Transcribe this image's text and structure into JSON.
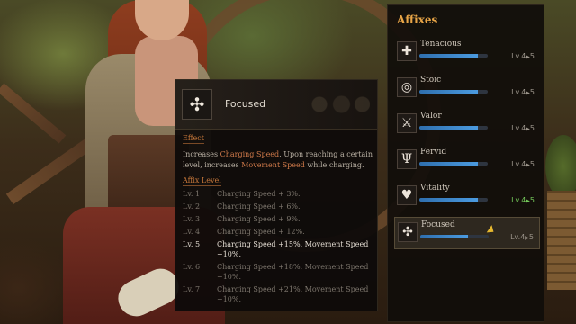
{
  "affixes_panel": {
    "title": "Affixes",
    "items": [
      {
        "name": "Tenacious",
        "icon": "heart-shield-icon",
        "glyph": "✚",
        "level": "Lv.4",
        "max": "5",
        "progress": 0.85,
        "maxed": false,
        "selected": false
      },
      {
        "name": "Stoic",
        "icon": "ring-icon",
        "glyph": "◎",
        "level": "Lv.4",
        "max": "5",
        "progress": 0.85,
        "maxed": false,
        "selected": false
      },
      {
        "name": "Valor",
        "icon": "sword-icon",
        "glyph": "⚔",
        "level": "Lv.4",
        "max": "5",
        "progress": 0.85,
        "maxed": false,
        "selected": false
      },
      {
        "name": "Fervid",
        "icon": "trident-icon",
        "glyph": "Ψ",
        "level": "Lv.4",
        "max": "5",
        "progress": 0.85,
        "maxed": false,
        "selected": false
      },
      {
        "name": "Vitality",
        "icon": "heartbeat-icon",
        "glyph": "♥",
        "level": "Lv.4",
        "max": "5",
        "progress": 0.85,
        "maxed": true,
        "selected": false
      },
      {
        "name": "Focused",
        "icon": "wing-icon",
        "glyph": "✣",
        "level": "Lv.4",
        "max": "5",
        "progress": 0.7,
        "maxed": false,
        "selected": true
      }
    ]
  },
  "tooltip": {
    "title": "Focused",
    "icon": "wing-icon",
    "glyph": "✣",
    "effect_heading": "Effect",
    "effect_parts": [
      "Increases ",
      "Charging Speed",
      ". Upon reaching a certain level, increases ",
      "Movement Speed",
      " while charging."
    ],
    "affix_level_heading": "Affix Level",
    "levels": [
      {
        "label": "Lv. 1",
        "text": "Charging Speed + 3%.",
        "current": false
      },
      {
        "label": "Lv. 2",
        "text": "Charging Speed + 6%.",
        "current": false
      },
      {
        "label": "Lv. 3",
        "text": "Charging Speed + 9%.",
        "current": false
      },
      {
        "label": "Lv. 4",
        "text": "Charging Speed + 12%.",
        "current": false
      },
      {
        "label": "Lv. 5",
        "text": "Charging Speed +15%. Movement Speed +10%.",
        "current": true
      },
      {
        "label": "Lv. 6",
        "text": "Charging Speed +18%. Movement Speed +10%.",
        "current": false
      },
      {
        "label": "Lv. 7",
        "text": "Charging Speed +21%. Movement Speed +10%.",
        "current": false
      }
    ]
  },
  "colors": {
    "accent_orange": "#e8a547",
    "highlight_text": "#d07a4a",
    "maxed_green": "#74c95a",
    "bar_blue": "#4b9be0"
  }
}
